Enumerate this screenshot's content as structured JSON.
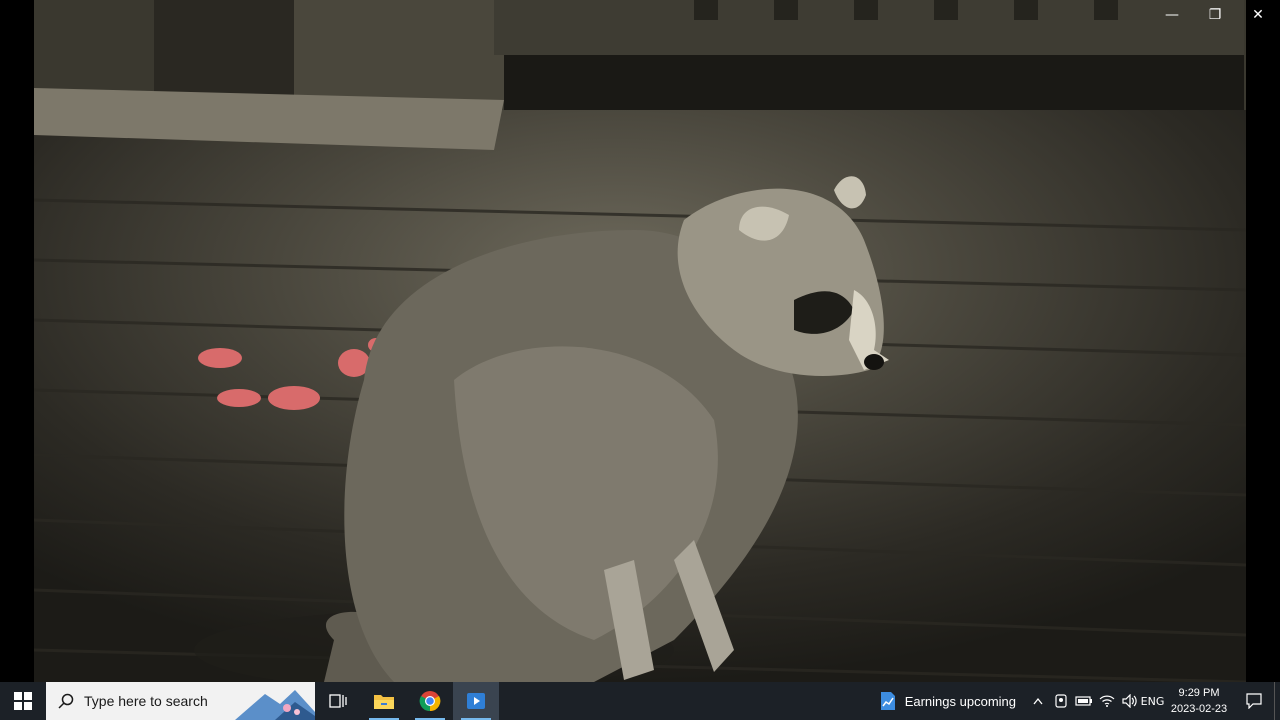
{
  "window": {
    "minimize_icon": "minimize-icon",
    "maximize_icon": "restore-icon",
    "close_icon": "close-icon",
    "minimize_glyph": "—",
    "maximize_glyph": "❐",
    "close_glyph": "✕"
  },
  "video": {
    "content": "raccoon-on-deck-photo"
  },
  "taskbar": {
    "start_icon": "windows-start-icon",
    "search_placeholder": "Type here to search",
    "pinned": [
      {
        "name": "task-view-icon"
      },
      {
        "name": "file-explorer-icon"
      },
      {
        "name": "chrome-icon"
      },
      {
        "name": "media-player-icon",
        "active": true
      }
    ],
    "news_label": "Earnings upcoming",
    "tray": {
      "chevron": "^",
      "language": "ENG",
      "time": "9:29 PM",
      "date": "2023-02-23"
    },
    "colors": {
      "taskbar_bg": "#1c2127",
      "search_bg": "#f2f2f2",
      "active_underline": "#76b9ed"
    }
  }
}
